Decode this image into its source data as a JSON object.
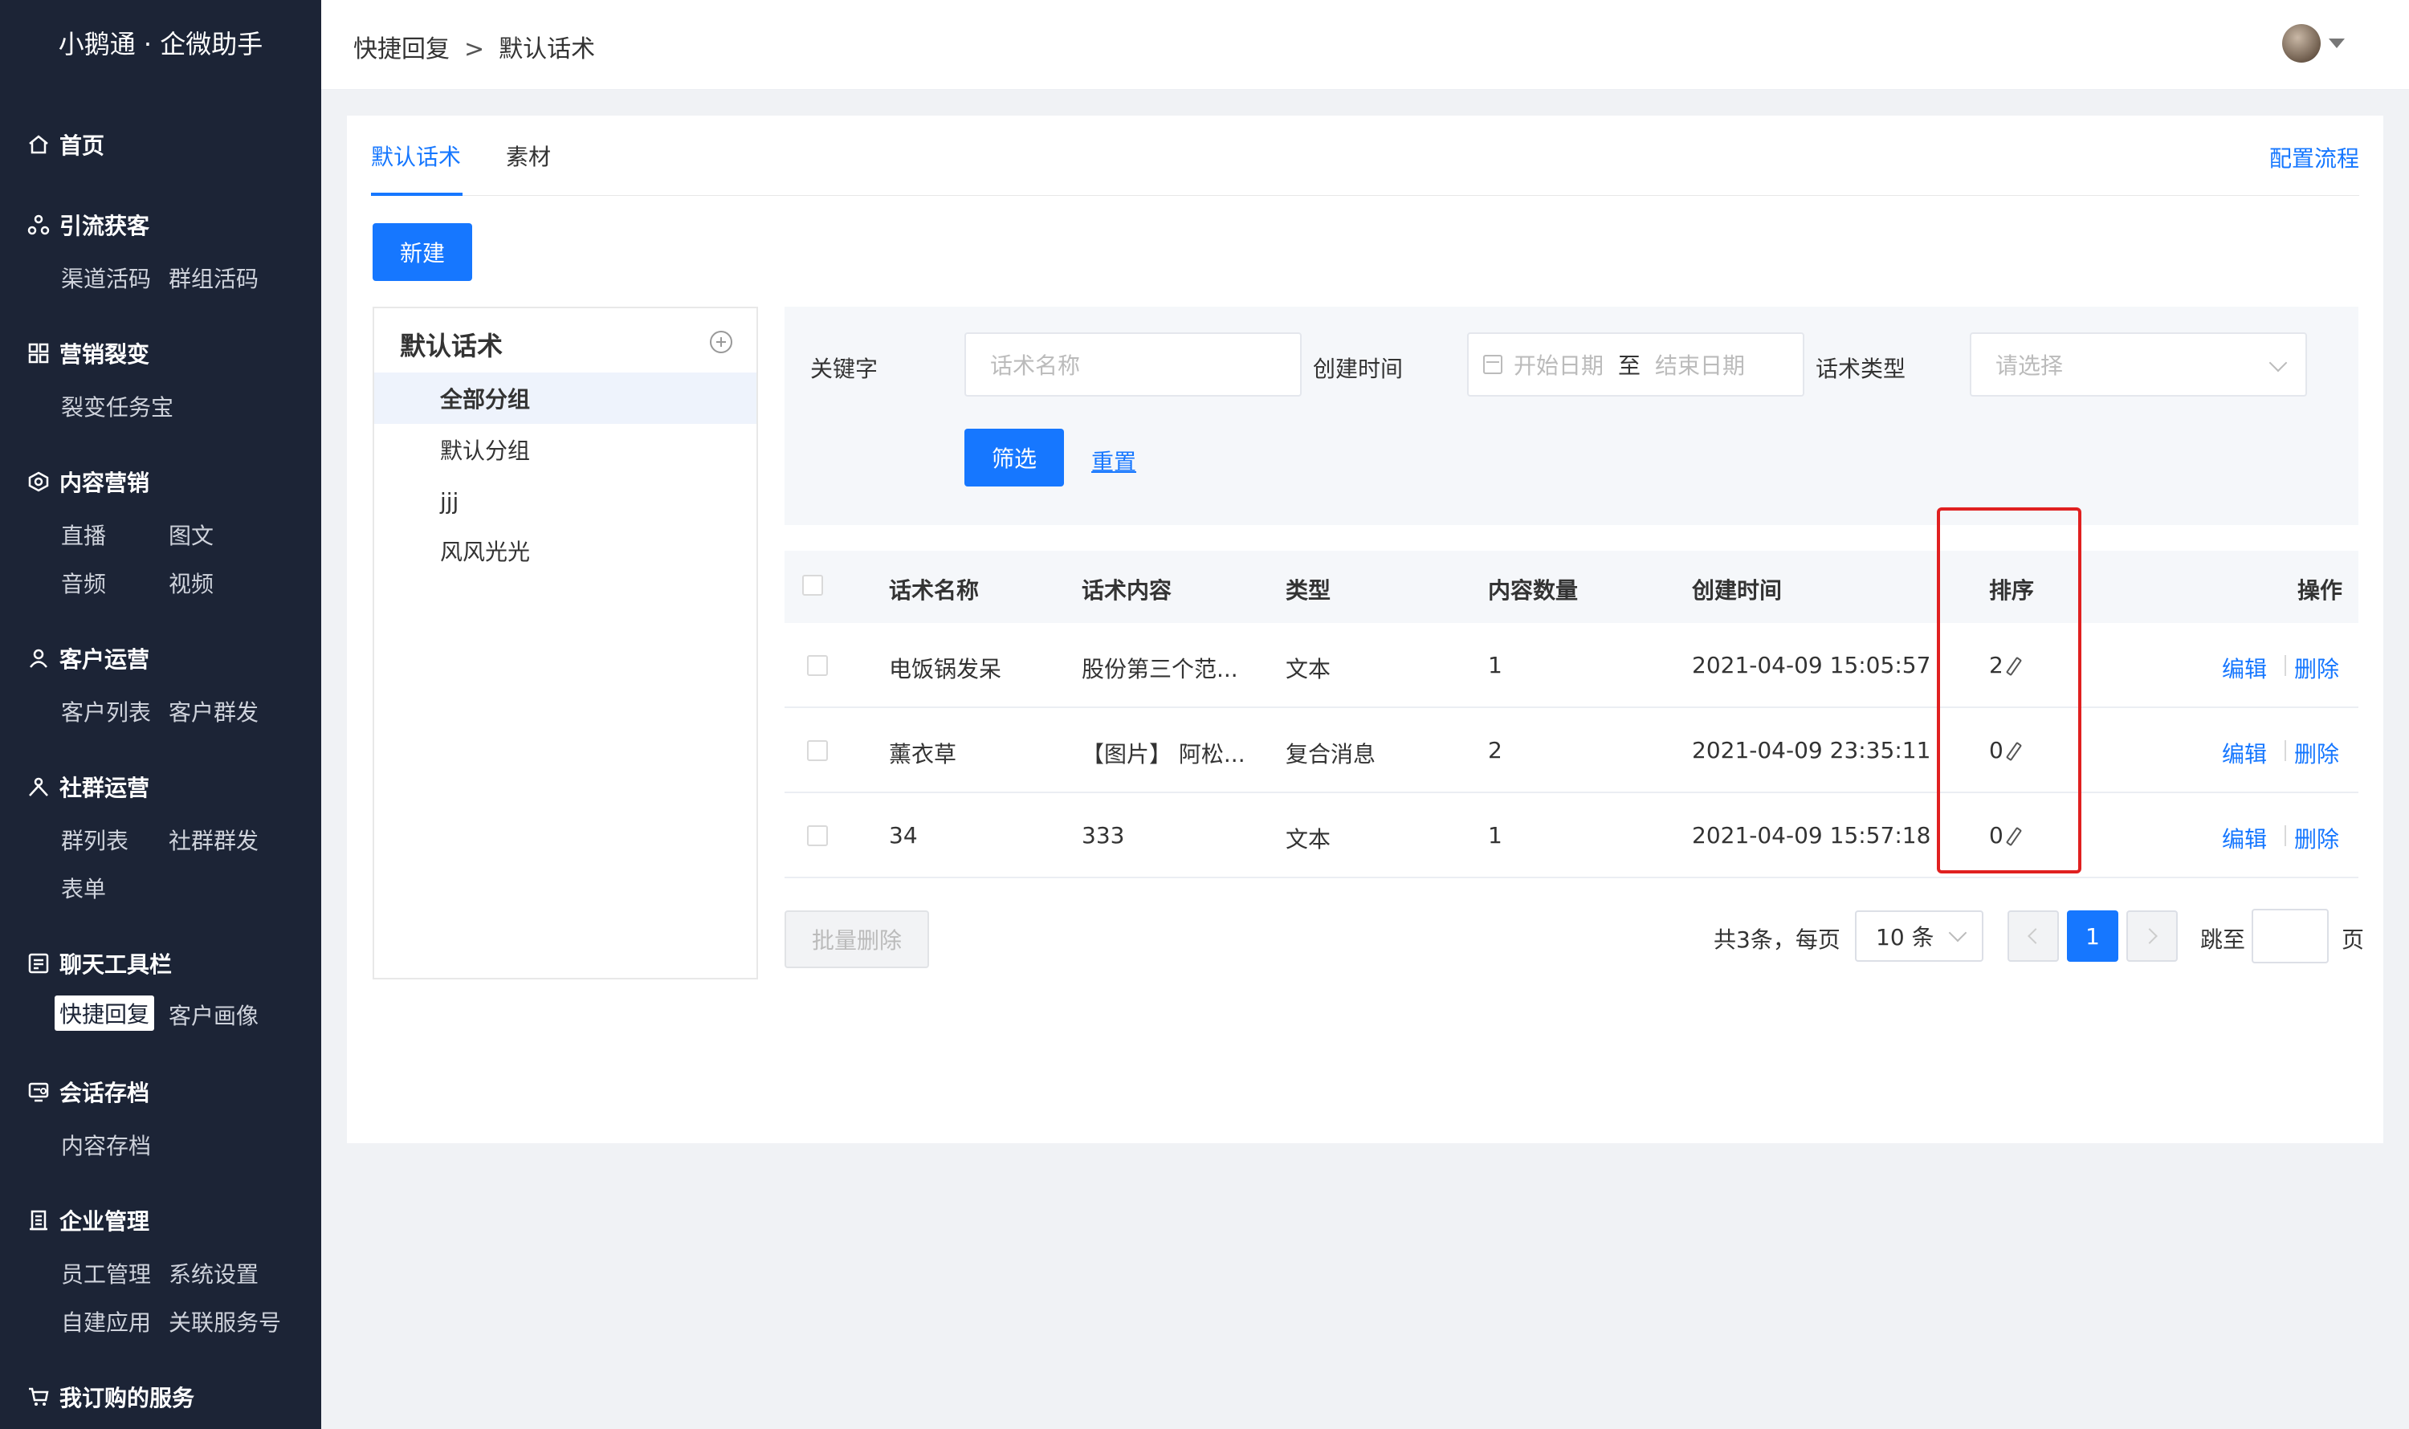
{
  "app": {
    "brand": "小鹅通 · 企微助手"
  },
  "sidebar": {
    "groups": [
      {
        "title": "首页",
        "icon": "home-icon",
        "items": []
      },
      {
        "title": "引流获客",
        "icon": "funnel-icon",
        "items": [
          "渠道活码",
          "群组活码"
        ]
      },
      {
        "title": "营销裂变",
        "icon": "grid-icon",
        "items": [
          "裂变任务宝"
        ]
      },
      {
        "title": "内容营销",
        "icon": "content-icon",
        "items": [
          "直播",
          "图文",
          "音频",
          "视频"
        ]
      },
      {
        "title": "客户运营",
        "icon": "user-icon",
        "items": [
          "客户列表",
          "客户群发"
        ]
      },
      {
        "title": "社群运营",
        "icon": "group-icon",
        "items": [
          "群列表",
          "社群群发",
          "表单"
        ]
      },
      {
        "title": "聊天工具栏",
        "icon": "toolbar-icon",
        "items": [
          "快捷回复",
          "客户画像"
        ]
      },
      {
        "title": "会话存档",
        "icon": "archive-icon",
        "items": [
          "内容存档"
        ]
      },
      {
        "title": "企业管理",
        "icon": "building-icon",
        "items": [
          "员工管理",
          "系统设置",
          "自建应用",
          "关联服务号"
        ]
      },
      {
        "title": "我订购的服务",
        "icon": "cart-icon",
        "items": []
      }
    ],
    "active_item": "快捷回复"
  },
  "header": {
    "breadcrumb": [
      "快捷回复",
      "默认话术"
    ],
    "breadcrumb_sep": ">"
  },
  "tabs": [
    {
      "label": "默认话术",
      "active": true
    },
    {
      "label": "素材",
      "active": false
    }
  ],
  "config_link": "配置流程",
  "new_button": "新建",
  "groups_panel": {
    "title": "默认话术",
    "items": [
      "全部分组",
      "默认分组",
      "jjj",
      "风风光光"
    ],
    "active": "全部分组"
  },
  "filter": {
    "keyword_label": "关键字",
    "keyword_placeholder": "话术名称",
    "created_label": "创建时间",
    "start_placeholder": "开始日期",
    "range_sep": "至",
    "end_placeholder": "结束日期",
    "type_label": "话术类型",
    "type_placeholder": "请选择",
    "filter_button": "筛选",
    "reset_link": "重置"
  },
  "table": {
    "columns": [
      "话术名称",
      "话术内容",
      "类型",
      "内容数量",
      "创建时间",
      "排序",
      "操作"
    ],
    "rows": [
      {
        "name": "电饭锅发呆",
        "content": "股份第三个范...",
        "type": "文本",
        "count": "1",
        "created": "2021-04-09 15:05:57",
        "sort": "2"
      },
      {
        "name": "薰衣草",
        "content": "【图片】 阿松...",
        "type": "复合消息",
        "count": "2",
        "created": "2021-04-09 23:35:11",
        "sort": "0"
      },
      {
        "name": "34",
        "content": "333",
        "type": "文本",
        "count": "1",
        "created": "2021-04-09 15:57:18",
        "sort": "0"
      }
    ],
    "actions": {
      "edit": "编辑",
      "delete": "删除"
    }
  },
  "footer": {
    "batch_delete": "批量删除",
    "total_text": "共3条，每页",
    "page_size": "10 条",
    "current_page": "1",
    "jump_label": "跳至",
    "page_unit": "页"
  },
  "colors": {
    "primary": "#1677ff",
    "sidebar_bg": "#1c2436",
    "highlight_box": "#e02020"
  }
}
